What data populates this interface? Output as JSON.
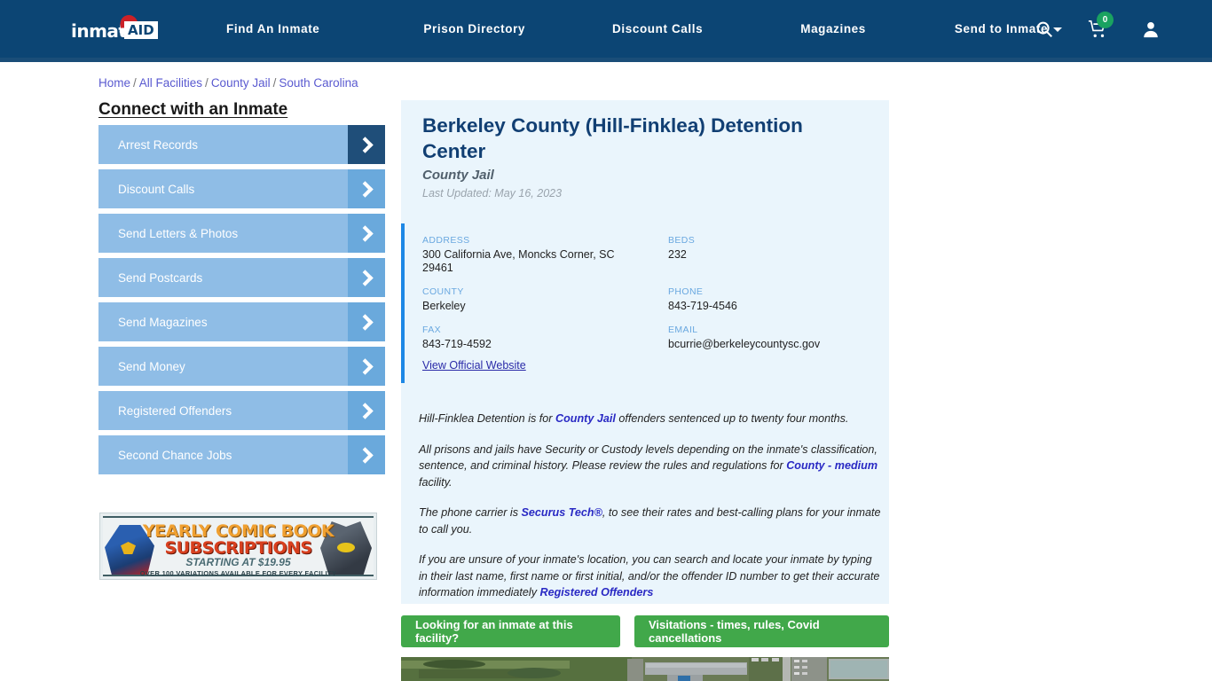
{
  "header": {
    "logo": {
      "text": "inmate",
      "badge": "AID",
      "icon": "santa-hat-icon"
    },
    "nav": [
      {
        "label": "Find An Inmate"
      },
      {
        "label": "Prison Directory"
      },
      {
        "label": "Discount Calls"
      },
      {
        "label": "Magazines"
      },
      {
        "label": "Send to Inmate",
        "has_caret": true
      }
    ],
    "icons": [
      {
        "name": "search-icon"
      },
      {
        "name": "cart-icon",
        "badge": "0",
        "badge_color": "#1aa260"
      },
      {
        "name": "user-account-icon"
      }
    ],
    "bg_color": "#0c4574"
  },
  "breadcrumb": {
    "items": [
      "Home",
      "All Facilities",
      "County Jail",
      "South Carolina"
    ],
    "separator": "/",
    "link_color": "#5a5ad0"
  },
  "sidebar": {
    "title": "Connect with an Inmate",
    "items": [
      {
        "label": "Arrest Records",
        "active": true
      },
      {
        "label": "Discount Calls",
        "active": false
      },
      {
        "label": "Send Letters & Photos",
        "active": false
      },
      {
        "label": "Send Postcards",
        "active": false
      },
      {
        "label": "Send Magazines",
        "active": false
      },
      {
        "label": "Send Money",
        "active": false
      },
      {
        "label": "Registered Offenders",
        "active": false
      },
      {
        "label": "Second Chance Jobs",
        "active": false
      }
    ],
    "ad": {
      "line1": "YEARLY COMIC BOOK",
      "line2": "SUBSCRIPTIONS",
      "line3": "STARTING AT $19.95",
      "line4": "OVER 100 VARIATIONS AVAILABLE FOR EVERY FACILITY"
    }
  },
  "facility": {
    "title": "Berkeley County (Hill-Finklea) Detention Center",
    "type": "County Jail",
    "last_updated": "Last Updated: May 16, 2023",
    "info": [
      {
        "label": "ADDRESS",
        "value": "300 California Ave, Moncks Corner, SC 29461"
      },
      {
        "label": "BEDS",
        "value": "232"
      },
      {
        "label": "COUNTY",
        "value": "Berkeley"
      },
      {
        "label": "PHONE",
        "value": "843-719-4546"
      },
      {
        "label": "FAX",
        "value": "843-719-4592"
      },
      {
        "label": "EMAIL",
        "value": "bcurrie@berkeleycountysc.gov"
      }
    ],
    "official_website_link": "View Official Website",
    "paragraphs": [
      {
        "parts": [
          {
            "t": "Hill-Finklea Detention is for ",
            "link": false
          },
          {
            "t": "County Jail",
            "link": true
          },
          {
            "t": " offenders sentenced up to twenty four months.",
            "link": false
          }
        ]
      },
      {
        "parts": [
          {
            "t": "All prisons and jails have Security or Custody levels depending on the inmate's classification, sentence, and criminal history. Please review the rules and regulations for ",
            "link": false
          },
          {
            "t": "County - medium",
            "link": true
          },
          {
            "t": " facility.",
            "link": false
          }
        ]
      },
      {
        "parts": [
          {
            "t": "The phone carrier is ",
            "link": false
          },
          {
            "t": "Securus Tech®",
            "link": true
          },
          {
            "t": ", to see their rates and best-calling plans for your inmate to call you.",
            "link": false
          }
        ]
      },
      {
        "parts": [
          {
            "t": "If you are unsure of your inmate's location, you can search and locate your inmate by typing in their last name, first name or first initial, and/or the offender ID number to get their accurate information immediately ",
            "link": false
          },
          {
            "t": "Registered Offenders",
            "link": true
          }
        ]
      }
    ]
  },
  "actions": {
    "inmate_search_label": "Looking for an inmate at this facility?",
    "visitation_label": "Visitations - times, rules, Covid cancellations",
    "button_color": "#41a84a"
  },
  "map": {
    "name": "satellite-aerial-view",
    "alt": "Aerial satellite view of facility"
  }
}
